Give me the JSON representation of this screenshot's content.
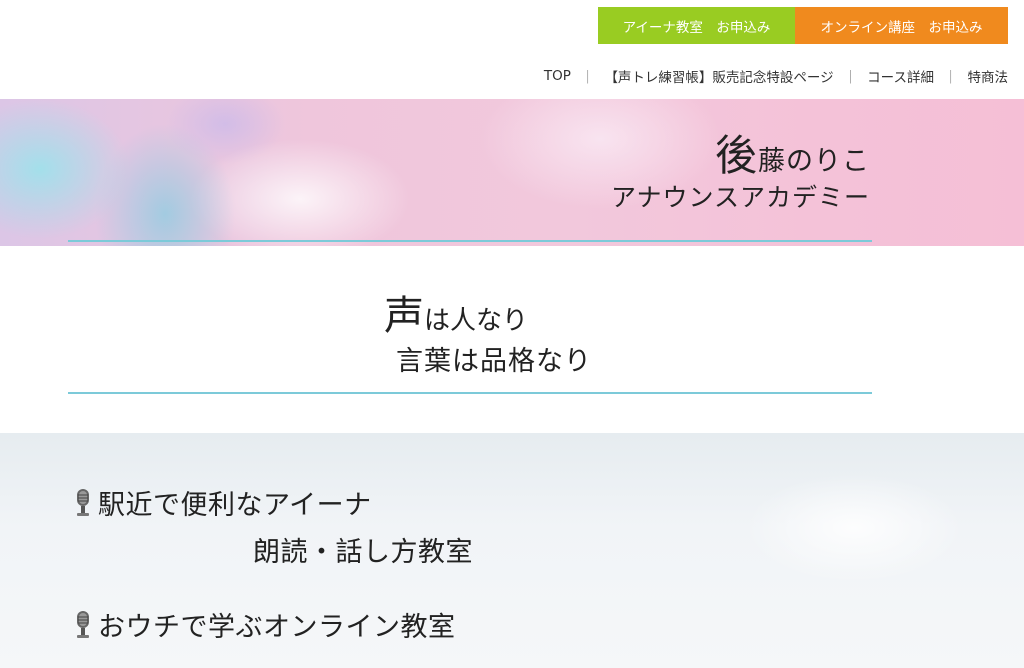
{
  "top_buttons": {
    "aina": "アイーナ教室　お申込み",
    "online": "オンライン講座　お申込み"
  },
  "nav": {
    "items": [
      "TOP",
      "【声トレ練習帳】販売記念特設ページ",
      "コース詳細",
      "特商法"
    ],
    "separator": "｜"
  },
  "hero": {
    "name_first": "後",
    "name_rest": "藤のりこ",
    "subtitle": "アナウンスアカデミー"
  },
  "motto": {
    "line1_first": "声",
    "line1_rest": "は人なり",
    "line2": "言葉は品格なり"
  },
  "courses": {
    "aina_line1": "駅近で便利なアイーナ",
    "aina_line2": "朗読・話し方教室",
    "online": "おウチで学ぶオンライン教室",
    "icon": "microphone-icon"
  },
  "colors": {
    "green_button": "#99cc22",
    "orange_button": "#f08a1e",
    "rule": "#7ccad9"
  }
}
